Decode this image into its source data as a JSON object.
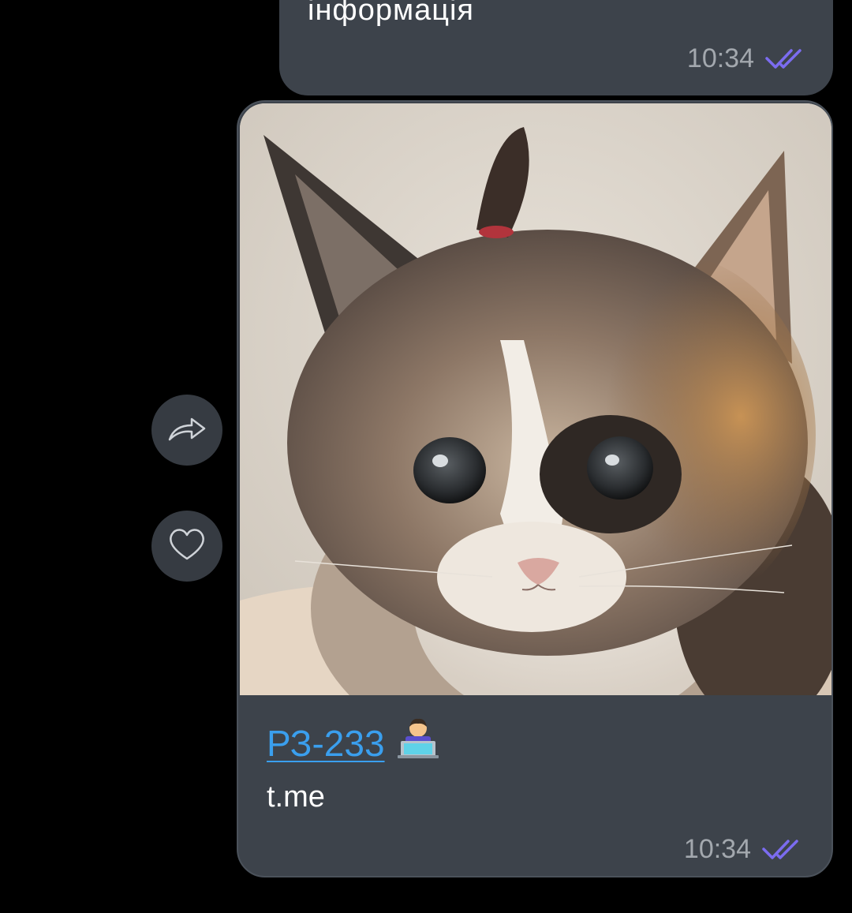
{
  "messages": {
    "previous": {
      "text": "інформація",
      "time": "10:34",
      "status_icon": "double-check-icon"
    },
    "link_preview": {
      "title": "РЗ-233",
      "title_emoji": "technologist-emoji",
      "domain": "t.me",
      "time": "10:34",
      "status_icon": "double-check-icon",
      "image": "kitten-photo"
    }
  },
  "actions": {
    "share_icon": "share-arrow-icon",
    "like_icon": "heart-icon"
  },
  "colors": {
    "background": "#000000",
    "bubble": "#3d434b",
    "link": "#3a9fee",
    "check": "#7b6cf0",
    "meta_text": "#a3a8ae",
    "side_button": "#363b42"
  }
}
